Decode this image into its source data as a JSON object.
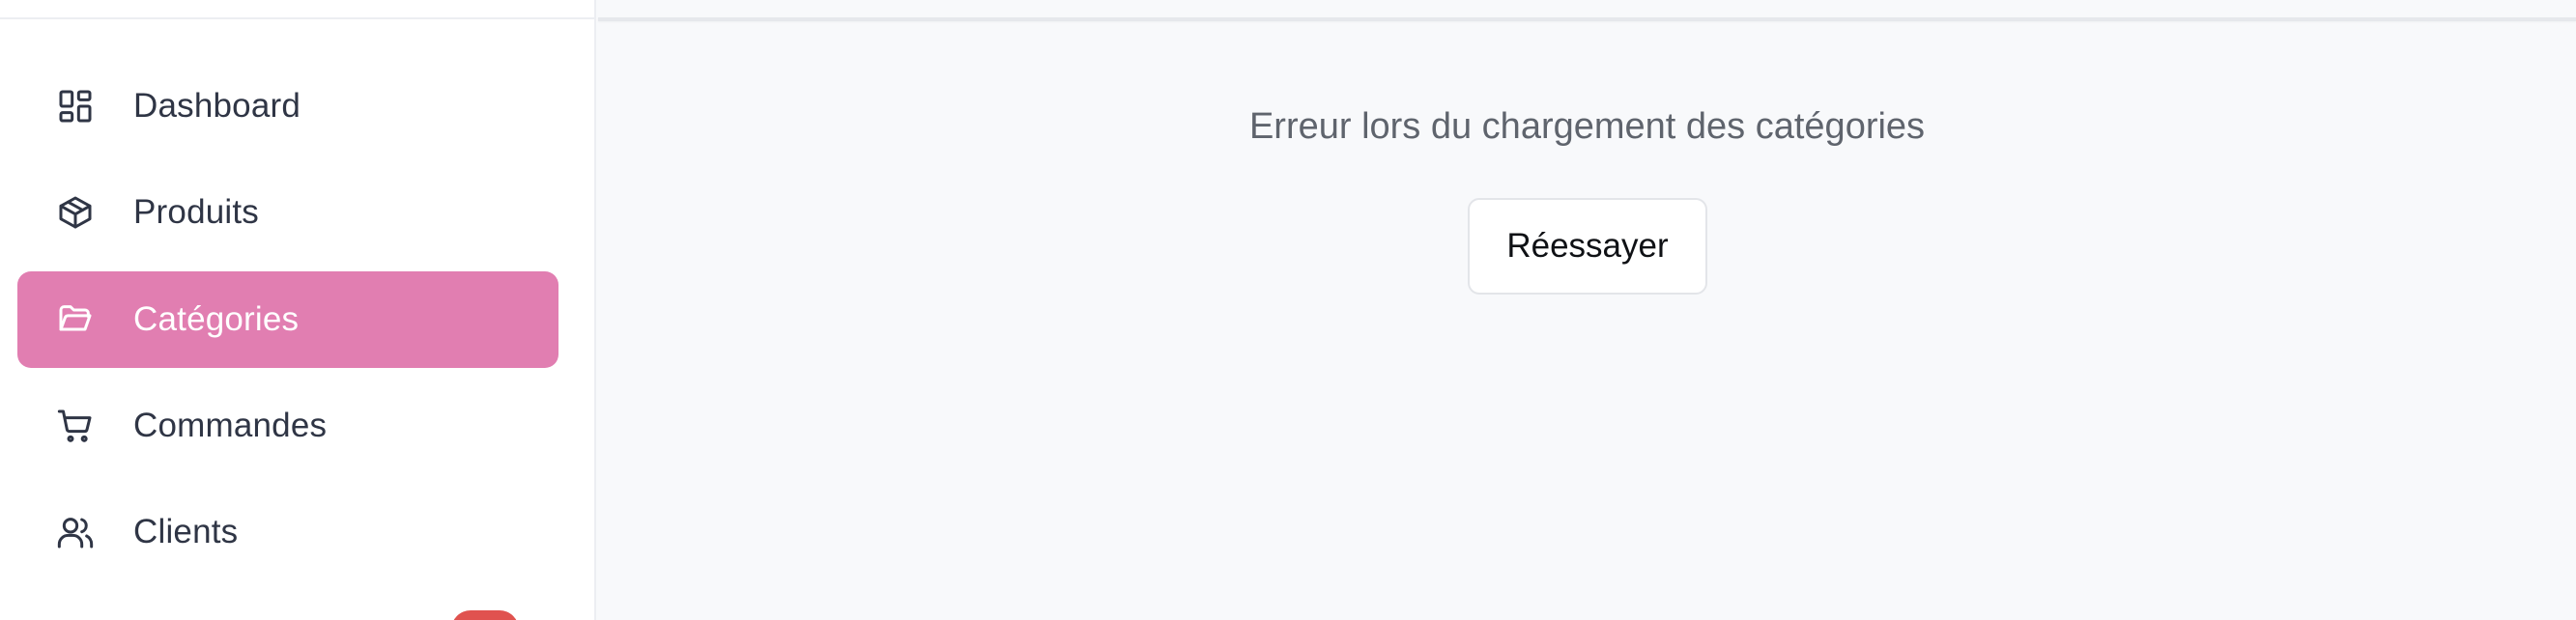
{
  "sidebar": {
    "items": [
      {
        "label": "Dashboard",
        "icon": "dashboard-grid-icon",
        "active": false
      },
      {
        "label": "Produits",
        "icon": "package-box-icon",
        "active": false
      },
      {
        "label": "Catégories",
        "icon": "folder-open-icon",
        "active": true
      },
      {
        "label": "Commandes",
        "icon": "shopping-cart-icon",
        "active": false
      },
      {
        "label": "Clients",
        "icon": "users-icon",
        "active": false
      }
    ],
    "active_color": "#e17eb1",
    "badge_color": "#e0524f"
  },
  "main": {
    "error_message": "Erreur lors du chargement des catégories",
    "retry_label": "Réessayer"
  }
}
